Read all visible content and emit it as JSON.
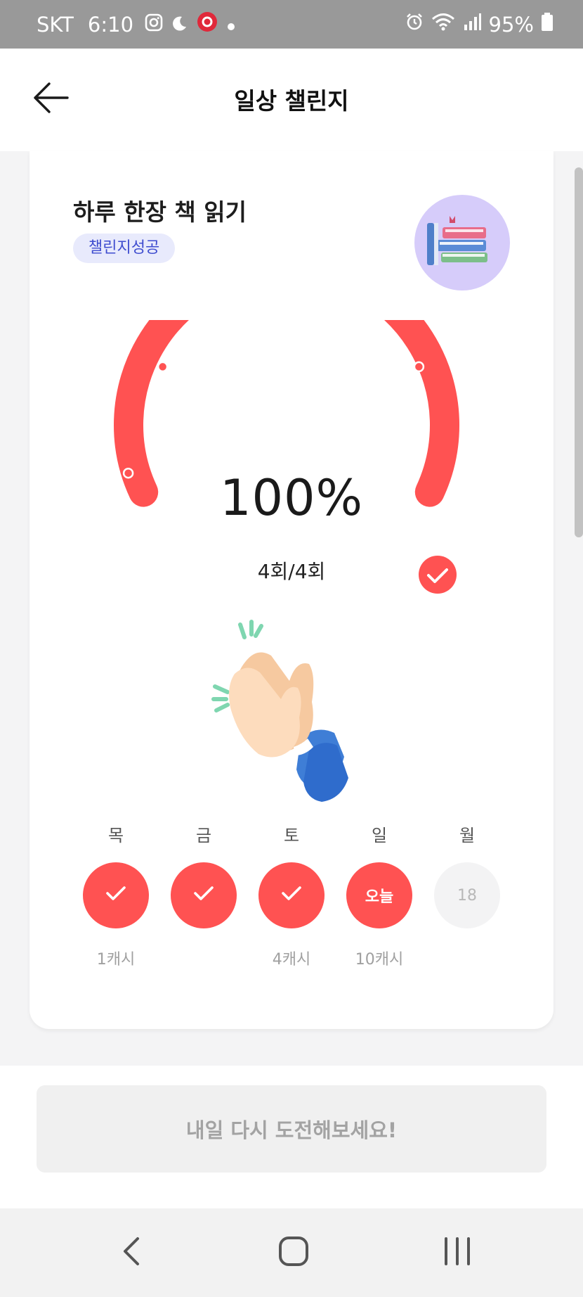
{
  "status_bar": {
    "carrier": "SKT",
    "time": "6:10",
    "battery": "95%",
    "icons": [
      "instagram-icon",
      "moon-icon",
      "record-icon",
      "dot-icon",
      "alarm-icon",
      "wifi-icon",
      "signal-icon",
      "battery-icon"
    ]
  },
  "header": {
    "title": "일상 챌린지",
    "back_icon": "arrow-left-icon"
  },
  "challenge": {
    "title": "하루 한장 책 읽기",
    "badge": "챌린지성공",
    "avatar_icon": "books-icon",
    "progress_percent": "100%",
    "progress_value": 1.0,
    "count_text": "4회/4회",
    "celebration_icon": "clapping-hands-icon"
  },
  "week": {
    "days": [
      {
        "label": "목",
        "state": "done",
        "circle_text": "",
        "reward": "1캐시"
      },
      {
        "label": "금",
        "state": "done",
        "circle_text": "",
        "reward": ""
      },
      {
        "label": "토",
        "state": "done",
        "circle_text": "",
        "reward": "4캐시"
      },
      {
        "label": "일",
        "state": "today",
        "circle_text": "오늘",
        "reward": "10캐시"
      },
      {
        "label": "월",
        "state": "future",
        "circle_text": "18",
        "reward": ""
      }
    ]
  },
  "action": {
    "button_label": "내일 다시 도전해보세요!"
  },
  "nav": {
    "icons": [
      "back-nav-icon",
      "home-nav-icon",
      "recents-nav-icon"
    ]
  },
  "colors": {
    "accent": "#ff5252",
    "badge_bg": "#e8eafc",
    "badge_text": "#3e4ccf"
  }
}
